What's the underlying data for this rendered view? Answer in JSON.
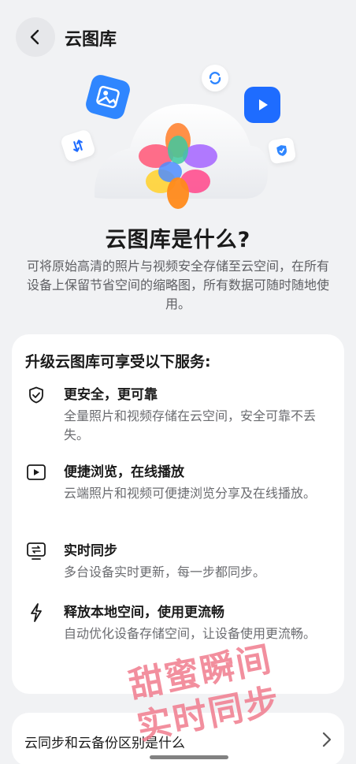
{
  "header": {
    "title": "云图库"
  },
  "hero": {
    "headline": "云图库是什么?",
    "description": "可将原始高清的照片与视频安全存储至云空间，在所有设备上保留节省空间的缩略图，所有数据可随时随地使用。"
  },
  "services": {
    "title": "升级云图库可享受以下服务:",
    "items": [
      {
        "icon": "shield-check-icon",
        "title": "更安全，更可靠",
        "desc": "全量照片和视频存储在云空间，安全可靠不丢失。"
      },
      {
        "icon": "play-icon",
        "title": "便捷浏览，在线播放",
        "desc": "云端照片和视频可便捷浏览分享及在线播放。"
      },
      {
        "icon": "sync-icon",
        "title": "实时同步",
        "desc": "多台设备实时更新，每一步都同步。"
      },
      {
        "icon": "lightning-icon",
        "title": "释放本地空间，使用更流畅",
        "desc": "自动优化设备存储空间，让设备使用更流畅。"
      }
    ]
  },
  "bottom": {
    "label": "云同步和云备份区别是什么"
  },
  "watermark": {
    "line1": "甜蜜瞬间",
    "line2": "实时同步"
  },
  "colors": {
    "accent": "#1a6cf0",
    "watermark": "#f07c8e",
    "background": "#f1f2f4"
  }
}
